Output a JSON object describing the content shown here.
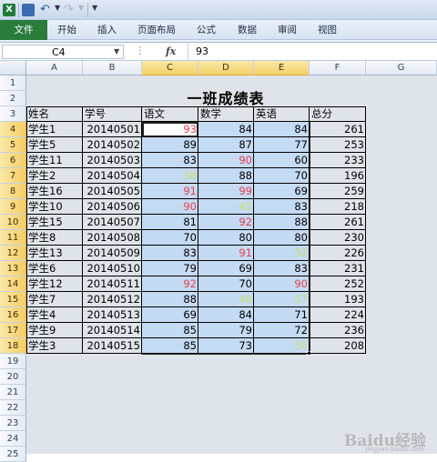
{
  "window": {
    "app_badge": "X"
  },
  "tabs": [
    {
      "label": "文件"
    },
    {
      "label": "开始"
    },
    {
      "label": "插入"
    },
    {
      "label": "页面布局"
    },
    {
      "label": "公式"
    },
    {
      "label": "数据"
    },
    {
      "label": "审阅"
    },
    {
      "label": "视图"
    }
  ],
  "formula_bar": {
    "name_box": "C4",
    "fx_label": "fx",
    "value": "93"
  },
  "columns": [
    "A",
    "B",
    "C",
    "D",
    "E",
    "F",
    "G"
  ],
  "rows": [
    "1",
    "2",
    "3",
    "4",
    "5",
    "6",
    "7",
    "8",
    "9",
    "10",
    "11",
    "12",
    "13",
    "14",
    "15",
    "16",
    "17",
    "18",
    "19",
    "20",
    "21",
    "22",
    "23",
    "24",
    "25"
  ],
  "sheet": {
    "title": "一班成绩表",
    "headers": [
      "姓名",
      "学号",
      "语文",
      "数学",
      "英语",
      "总分"
    ],
    "records": [
      {
        "name": "学生1",
        "id": "20140501",
        "chinese": "93",
        "math": "84",
        "english": "84",
        "total": "261"
      },
      {
        "name": "学生5",
        "id": "20140502",
        "chinese": "89",
        "math": "87",
        "english": "77",
        "total": "253"
      },
      {
        "name": "学生11",
        "id": "20140503",
        "chinese": "83",
        "math": "90",
        "english": "60",
        "total": "233"
      },
      {
        "name": "学生2",
        "id": "20140504",
        "chinese": "38",
        "math": "88",
        "english": "70",
        "total": "196"
      },
      {
        "name": "学生16",
        "id": "20140505",
        "chinese": "91",
        "math": "99",
        "english": "69",
        "total": "259"
      },
      {
        "name": "学生10",
        "id": "20140506",
        "chinese": "90",
        "math": "45",
        "english": "83",
        "total": "218"
      },
      {
        "name": "学生15",
        "id": "20140507",
        "chinese": "81",
        "math": "92",
        "english": "88",
        "total": "261"
      },
      {
        "name": "学生8",
        "id": "20140508",
        "chinese": "70",
        "math": "80",
        "english": "80",
        "total": "230"
      },
      {
        "name": "学生13",
        "id": "20140509",
        "chinese": "83",
        "math": "91",
        "english": "52",
        "total": "226"
      },
      {
        "name": "学生6",
        "id": "20140510",
        "chinese": "79",
        "math": "69",
        "english": "83",
        "total": "231"
      },
      {
        "name": "学生12",
        "id": "20140511",
        "chinese": "92",
        "math": "70",
        "english": "90",
        "total": "252"
      },
      {
        "name": "学生7",
        "id": "20140512",
        "chinese": "88",
        "math": "48",
        "english": "57",
        "total": "193"
      },
      {
        "name": "学生4",
        "id": "20140513",
        "chinese": "69",
        "math": "84",
        "english": "71",
        "total": "224"
      },
      {
        "name": "学生9",
        "id": "20140514",
        "chinese": "85",
        "math": "79",
        "english": "72",
        "total": "236"
      },
      {
        "name": "学生3",
        "id": "20140515",
        "chinese": "85",
        "math": "73",
        "english": "50",
        "total": "208"
      }
    ]
  },
  "colors": {
    "high_score": "#e8404a",
    "low_score": "#c7df6b",
    "selection": "#c5daf3",
    "header_selected": "#f4cf6a",
    "file_tab": "#2a7c3c"
  },
  "watermark": {
    "text": "Baidu经验",
    "sub": "jingyan.baidu.com"
  }
}
